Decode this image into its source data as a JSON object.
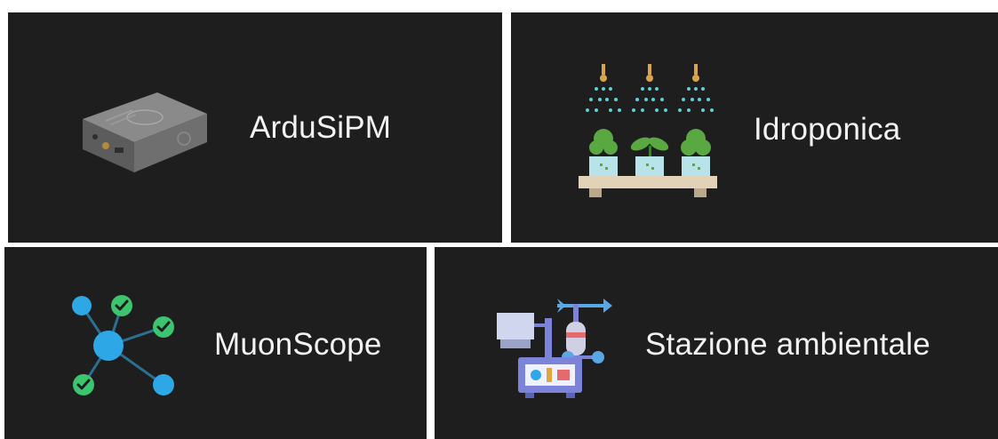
{
  "tiles": [
    {
      "label": "ArduSiPM",
      "icon": "ardusipm-device-icon"
    },
    {
      "label": "Idroponica",
      "icon": "hydroponics-icon"
    },
    {
      "label": "MuonScope",
      "icon": "network-nodes-icon"
    },
    {
      "label": "Stazione ambientale",
      "icon": "weather-station-icon"
    }
  ],
  "colors": {
    "tile_background": "#1e1e1e",
    "label_text": "#f2f2f2",
    "node_blue": "#2ea7e6",
    "check_green": "#3cc46e",
    "plant_green": "#59a842"
  }
}
